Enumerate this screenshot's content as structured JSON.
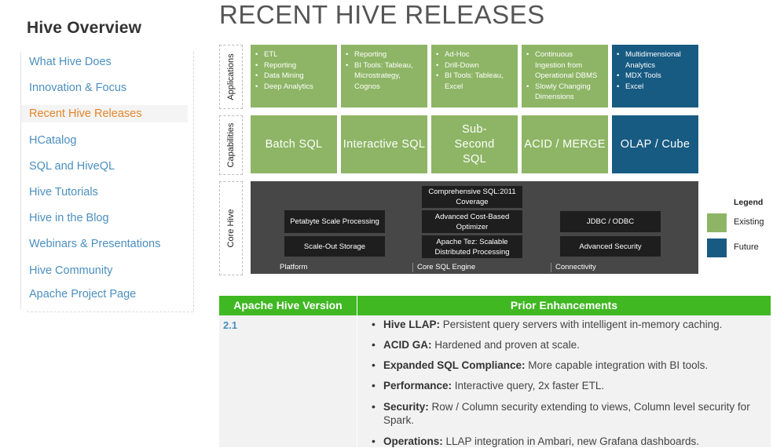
{
  "sidebar": {
    "title": "Hive Overview",
    "items": [
      {
        "label": "What Hive Does"
      },
      {
        "label": "Innovation & Focus"
      },
      {
        "label": "Recent Hive Releases"
      },
      {
        "label": "HCatalog"
      },
      {
        "label": "SQL and HiveQL"
      },
      {
        "label": "Hive Tutorials"
      },
      {
        "label": "Hive in the Blog"
      },
      {
        "label": "Webinars & Presentations"
      },
      {
        "label": "Hive Community"
      },
      {
        "label": "Apache Project Page"
      }
    ],
    "active_item": "Recent Hive Releases"
  },
  "page_title": "RECENT HIVE RELEASES",
  "diagram": {
    "rows": {
      "applications": "Applications",
      "capabilities": "Capabilities",
      "core": "Core Hive"
    },
    "applications": [
      {
        "items": [
          "ETL",
          "Reporting",
          "Data Mining",
          "Deep Analytics"
        ],
        "status": "existing"
      },
      {
        "items": [
          "Reporting",
          "BI Tools: Tableau, Microstrategy, Cognos"
        ],
        "status": "existing"
      },
      {
        "items": [
          "Ad-Hoc",
          "Drill-Down",
          "BI Tools: Tableau, Excel"
        ],
        "status": "existing"
      },
      {
        "items": [
          "Continuous Ingestion from Operational DBMS",
          "Slowly Changing Dimensions"
        ],
        "status": "existing"
      },
      {
        "items": [
          "Multidimensional Analytics",
          "MDX Tools",
          "Excel"
        ],
        "status": "future"
      }
    ],
    "capabilities": [
      {
        "label": "Batch SQL",
        "status": "existing"
      },
      {
        "label": "Interactive SQL",
        "status": "existing"
      },
      {
        "label": "Sub-Second SQL",
        "status": "existing"
      },
      {
        "label": "ACID / MERGE",
        "status": "existing"
      },
      {
        "label": "OLAP / Cube",
        "status": "future"
      }
    ],
    "core": {
      "platform": {
        "label": "Platform",
        "boxes": [
          "Petabyte Scale Processing",
          "Scale-Out Storage"
        ]
      },
      "engine": {
        "label": "Core SQL Engine",
        "boxes": [
          "Comprehensive SQL:2011 Coverage",
          "Advanced Cost-Based Optimizer",
          "Apache Tez: Scalable Distributed Processing"
        ]
      },
      "connectivity": {
        "label": "Connectivity",
        "boxes": [
          "JDBC / ODBC",
          "Advanced Security"
        ]
      }
    },
    "legend": {
      "title": "Legend",
      "existing": "Existing",
      "future": "Future"
    }
  },
  "colors": {
    "existing": "#8db565",
    "future": "#175a82",
    "table_header": "#3fb822",
    "link": "#4b8fbf",
    "active_link": "#e2862a"
  },
  "table": {
    "headers": [
      "Apache Hive Version",
      "Prior Enhancements"
    ],
    "version": "2.1",
    "enhancements": [
      {
        "title": "Hive LLAP:",
        "text": " Persistent query servers with intelligent in-memory caching."
      },
      {
        "title": "ACID GA:",
        "text": " Hardened and proven at scale."
      },
      {
        "title": "Expanded SQL Compliance:",
        "text": " More capable integration with BI tools."
      },
      {
        "title": "Performance:",
        "text": " Interactive query, 2x faster ETL."
      },
      {
        "title": "Security:",
        "text": " Row / Column security extending to views, Column level security for Spark."
      },
      {
        "title": "Operations:",
        "text": " LLAP integration in Ambari, new Grafana dashboards."
      }
    ]
  }
}
